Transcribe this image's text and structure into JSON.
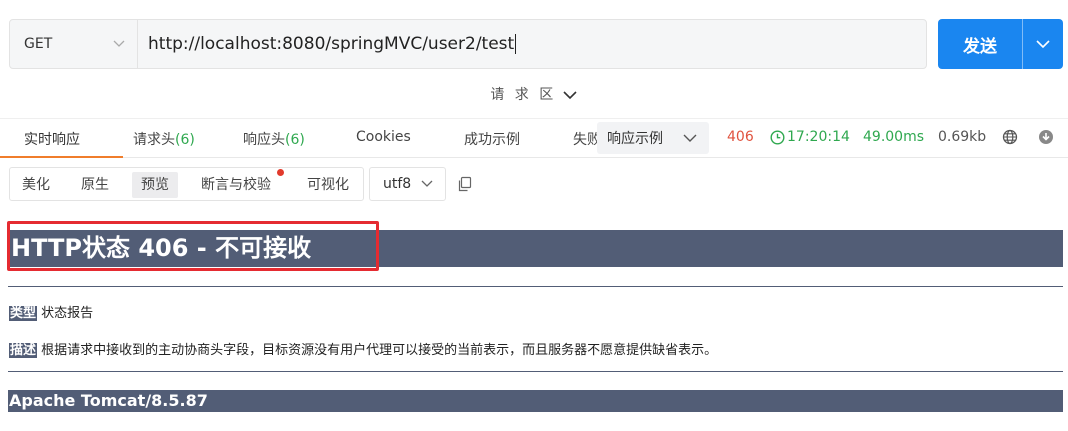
{
  "request": {
    "method": "GET",
    "url": "http://localhost:8080/springMVC/user2/test",
    "send_label": "发送"
  },
  "request_area_label": "请 求 区",
  "tabs": [
    {
      "label": "实时响应",
      "count": ""
    },
    {
      "label": "请求头",
      "count": "(6)"
    },
    {
      "label": "响应头",
      "count": "(6)"
    },
    {
      "label": "Cookies",
      "count": ""
    },
    {
      "label": "成功示例",
      "count": ""
    },
    {
      "label": "失败",
      "count": ""
    }
  ],
  "response_example_select": "响应示例",
  "status": {
    "code": "406",
    "time": "17:20:14",
    "duration": "49.00ms",
    "size": "0.69kb"
  },
  "view_modes": [
    "美化",
    "原生",
    "预览",
    "断言与校验",
    "可视化"
  ],
  "active_view": "预览",
  "encoding": "utf8",
  "preview": {
    "title": "HTTP状态 406 - 不可接收",
    "type_label": "类型",
    "type_value": "状态报告",
    "desc_label": "描述",
    "desc_value": "根据请求中接收到的主动协商头字段，目标资源没有用户代理可以接受的当前表示，而且服务器不愿意提供缺省表示。",
    "footer": "Apache Tomcat/8.5.87"
  },
  "colors": {
    "accent": "#1a86f0",
    "tab_active_underline": "#f07d2b",
    "status_error": "#e0533f",
    "success": "#2fa84f",
    "tomcat_header": "#525d76",
    "highlight_box": "#e52b31"
  }
}
